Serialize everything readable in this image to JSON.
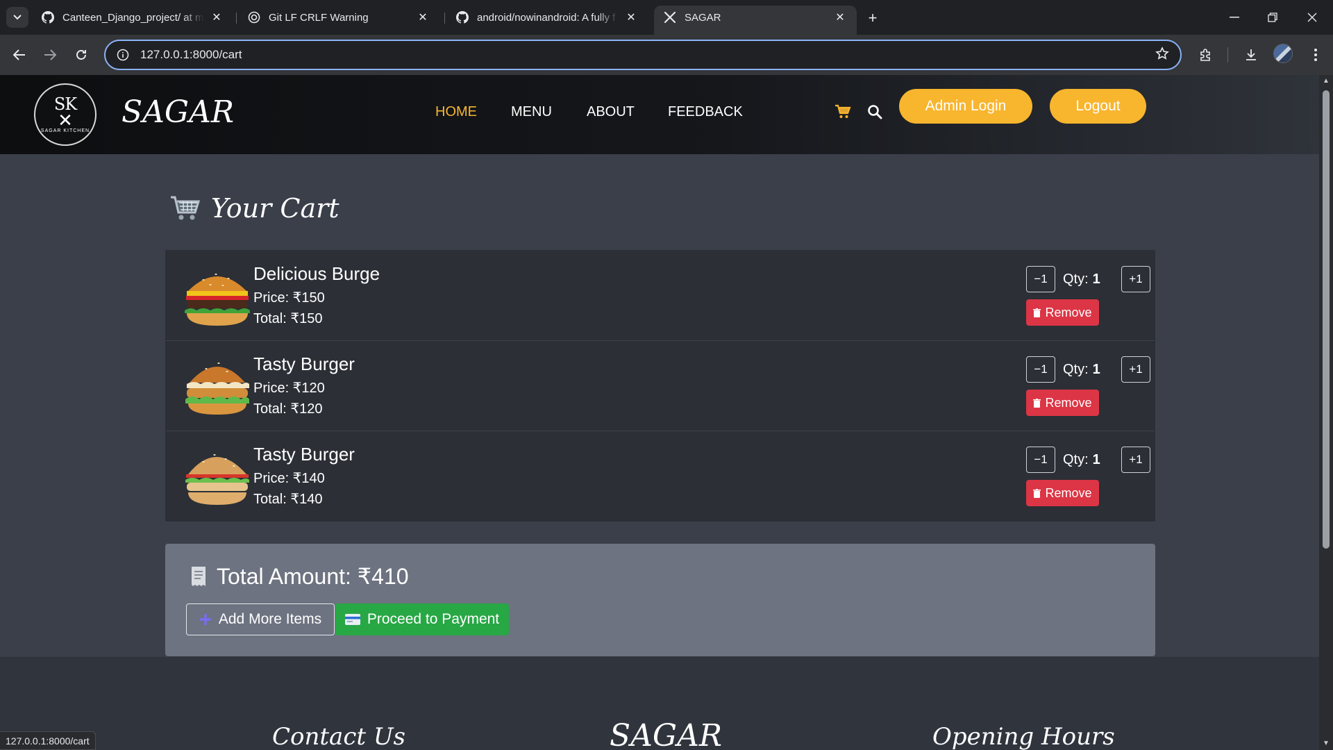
{
  "browser": {
    "tabs": [
      {
        "title": "Canteen_Django_project/ at ma",
        "icon": "github-icon",
        "active": false
      },
      {
        "title": "Git LF CRLF Warning",
        "icon": "openai-icon",
        "active": false
      },
      {
        "title": "android/nowinandroid: A fully f",
        "icon": "github-icon",
        "active": false
      },
      {
        "title": "SAGAR",
        "icon": "fork-knife-icon",
        "active": true
      }
    ],
    "url": "127.0.0.1:8000/cart",
    "status_url": "127.0.0.1:8000/cart"
  },
  "site": {
    "logo": {
      "initials": "SK",
      "ring_text": "SAGAR KITCHEN"
    },
    "brand": "SAGAR",
    "nav": [
      "HOME",
      "MENU",
      "ABOUT",
      "FEEDBACK"
    ],
    "active_nav": "HOME",
    "admin_login": "Admin Login",
    "logout": "Logout",
    "accent_color": "#f8b52e"
  },
  "cart": {
    "title": "Your Cart",
    "qty_label": "Qty:",
    "minus_label": "−1",
    "plus_label": "+1",
    "remove_label": "Remove",
    "items": [
      {
        "name": "Delicious Burge",
        "price": "Price: ₹150",
        "total": "Total: ₹150",
        "qty": "1"
      },
      {
        "name": "Tasty Burger",
        "price": "Price: ₹120",
        "total": "Total: ₹120",
        "qty": "1"
      },
      {
        "name": "Tasty Burger",
        "price": "Price: ₹140",
        "total": "Total: ₹140",
        "qty": "1"
      }
    ],
    "total_amount": "Total Amount: ₹410",
    "add_more": "Add More Items",
    "proceed": "Proceed to Payment"
  },
  "footer": {
    "contact": "Contact Us",
    "brand": "SAGAR",
    "hours": "Opening Hours"
  }
}
